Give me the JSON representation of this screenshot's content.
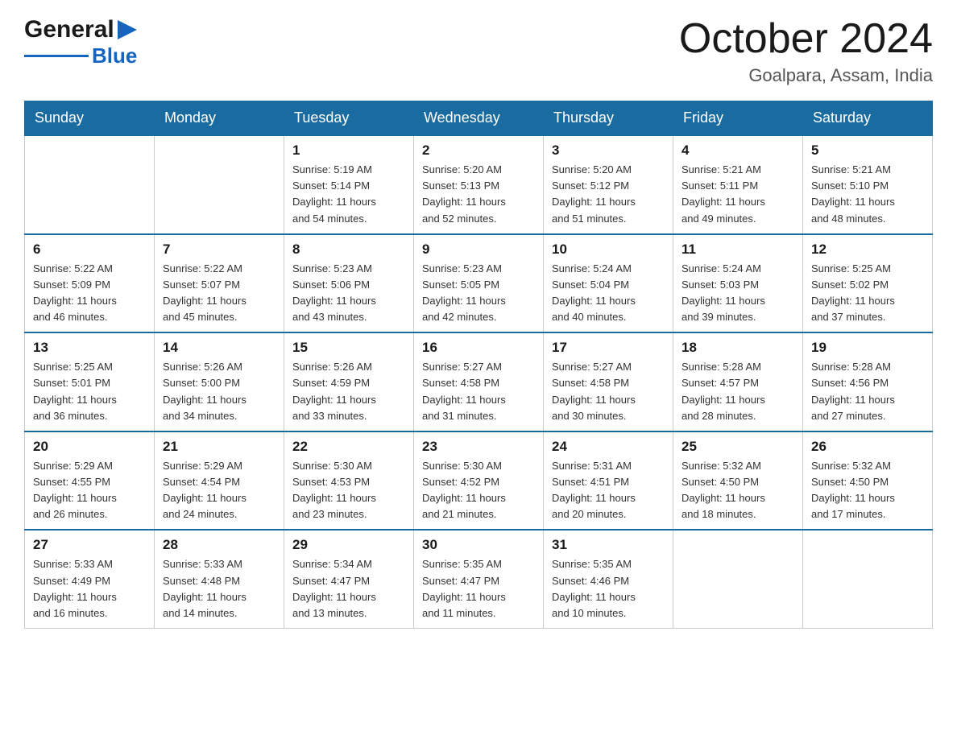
{
  "header": {
    "logo": {
      "general": "General",
      "triangle_char": "▶",
      "blue": "Blue"
    },
    "title": "October 2024",
    "subtitle": "Goalpara, Assam, India"
  },
  "weekdays": [
    "Sunday",
    "Monday",
    "Tuesday",
    "Wednesday",
    "Thursday",
    "Friday",
    "Saturday"
  ],
  "weeks": [
    [
      {
        "day": "",
        "info": ""
      },
      {
        "day": "",
        "info": ""
      },
      {
        "day": "1",
        "info": "Sunrise: 5:19 AM\nSunset: 5:14 PM\nDaylight: 11 hours\nand 54 minutes."
      },
      {
        "day": "2",
        "info": "Sunrise: 5:20 AM\nSunset: 5:13 PM\nDaylight: 11 hours\nand 52 minutes."
      },
      {
        "day": "3",
        "info": "Sunrise: 5:20 AM\nSunset: 5:12 PM\nDaylight: 11 hours\nand 51 minutes."
      },
      {
        "day": "4",
        "info": "Sunrise: 5:21 AM\nSunset: 5:11 PM\nDaylight: 11 hours\nand 49 minutes."
      },
      {
        "day": "5",
        "info": "Sunrise: 5:21 AM\nSunset: 5:10 PM\nDaylight: 11 hours\nand 48 minutes."
      }
    ],
    [
      {
        "day": "6",
        "info": "Sunrise: 5:22 AM\nSunset: 5:09 PM\nDaylight: 11 hours\nand 46 minutes."
      },
      {
        "day": "7",
        "info": "Sunrise: 5:22 AM\nSunset: 5:07 PM\nDaylight: 11 hours\nand 45 minutes."
      },
      {
        "day": "8",
        "info": "Sunrise: 5:23 AM\nSunset: 5:06 PM\nDaylight: 11 hours\nand 43 minutes."
      },
      {
        "day": "9",
        "info": "Sunrise: 5:23 AM\nSunset: 5:05 PM\nDaylight: 11 hours\nand 42 minutes."
      },
      {
        "day": "10",
        "info": "Sunrise: 5:24 AM\nSunset: 5:04 PM\nDaylight: 11 hours\nand 40 minutes."
      },
      {
        "day": "11",
        "info": "Sunrise: 5:24 AM\nSunset: 5:03 PM\nDaylight: 11 hours\nand 39 minutes."
      },
      {
        "day": "12",
        "info": "Sunrise: 5:25 AM\nSunset: 5:02 PM\nDaylight: 11 hours\nand 37 minutes."
      }
    ],
    [
      {
        "day": "13",
        "info": "Sunrise: 5:25 AM\nSunset: 5:01 PM\nDaylight: 11 hours\nand 36 minutes."
      },
      {
        "day": "14",
        "info": "Sunrise: 5:26 AM\nSunset: 5:00 PM\nDaylight: 11 hours\nand 34 minutes."
      },
      {
        "day": "15",
        "info": "Sunrise: 5:26 AM\nSunset: 4:59 PM\nDaylight: 11 hours\nand 33 minutes."
      },
      {
        "day": "16",
        "info": "Sunrise: 5:27 AM\nSunset: 4:58 PM\nDaylight: 11 hours\nand 31 minutes."
      },
      {
        "day": "17",
        "info": "Sunrise: 5:27 AM\nSunset: 4:58 PM\nDaylight: 11 hours\nand 30 minutes."
      },
      {
        "day": "18",
        "info": "Sunrise: 5:28 AM\nSunset: 4:57 PM\nDaylight: 11 hours\nand 28 minutes."
      },
      {
        "day": "19",
        "info": "Sunrise: 5:28 AM\nSunset: 4:56 PM\nDaylight: 11 hours\nand 27 minutes."
      }
    ],
    [
      {
        "day": "20",
        "info": "Sunrise: 5:29 AM\nSunset: 4:55 PM\nDaylight: 11 hours\nand 26 minutes."
      },
      {
        "day": "21",
        "info": "Sunrise: 5:29 AM\nSunset: 4:54 PM\nDaylight: 11 hours\nand 24 minutes."
      },
      {
        "day": "22",
        "info": "Sunrise: 5:30 AM\nSunset: 4:53 PM\nDaylight: 11 hours\nand 23 minutes."
      },
      {
        "day": "23",
        "info": "Sunrise: 5:30 AM\nSunset: 4:52 PM\nDaylight: 11 hours\nand 21 minutes."
      },
      {
        "day": "24",
        "info": "Sunrise: 5:31 AM\nSunset: 4:51 PM\nDaylight: 11 hours\nand 20 minutes."
      },
      {
        "day": "25",
        "info": "Sunrise: 5:32 AM\nSunset: 4:50 PM\nDaylight: 11 hours\nand 18 minutes."
      },
      {
        "day": "26",
        "info": "Sunrise: 5:32 AM\nSunset: 4:50 PM\nDaylight: 11 hours\nand 17 minutes."
      }
    ],
    [
      {
        "day": "27",
        "info": "Sunrise: 5:33 AM\nSunset: 4:49 PM\nDaylight: 11 hours\nand 16 minutes."
      },
      {
        "day": "28",
        "info": "Sunrise: 5:33 AM\nSunset: 4:48 PM\nDaylight: 11 hours\nand 14 minutes."
      },
      {
        "day": "29",
        "info": "Sunrise: 5:34 AM\nSunset: 4:47 PM\nDaylight: 11 hours\nand 13 minutes."
      },
      {
        "day": "30",
        "info": "Sunrise: 5:35 AM\nSunset: 4:47 PM\nDaylight: 11 hours\nand 11 minutes."
      },
      {
        "day": "31",
        "info": "Sunrise: 5:35 AM\nSunset: 4:46 PM\nDaylight: 11 hours\nand 10 minutes."
      },
      {
        "day": "",
        "info": ""
      },
      {
        "day": "",
        "info": ""
      }
    ]
  ]
}
